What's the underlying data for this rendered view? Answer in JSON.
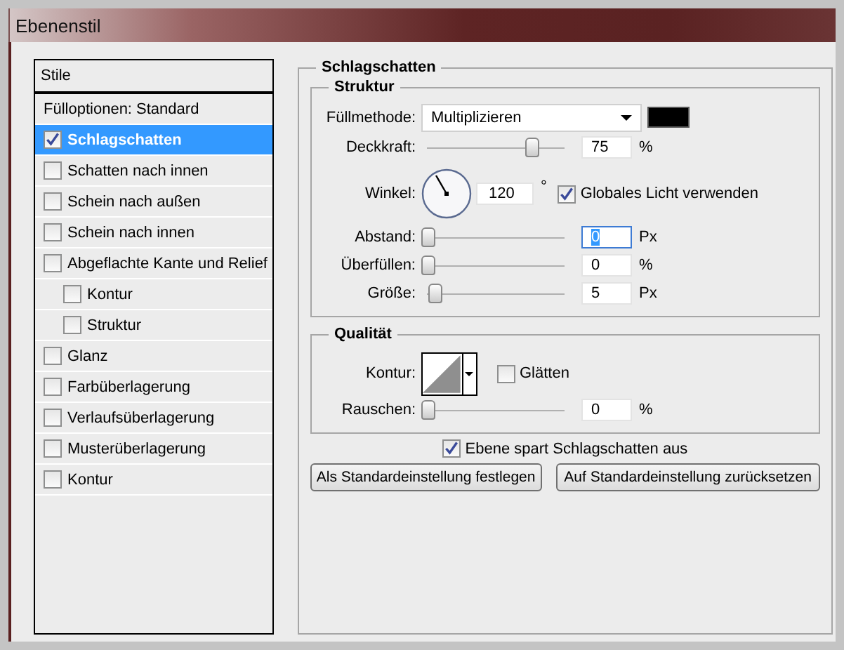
{
  "window": {
    "title": "Ebenenstil"
  },
  "styles": {
    "header": "Stile",
    "items": [
      {
        "label": "Fülloptionen: Standard",
        "kind": "plain",
        "selected": false
      },
      {
        "label": "Schlagschatten",
        "kind": "check",
        "checked": true,
        "selected": true
      },
      {
        "label": "Schatten nach innen",
        "kind": "check",
        "checked": false,
        "selected": false
      },
      {
        "label": "Schein nach außen",
        "kind": "check",
        "checked": false,
        "selected": false
      },
      {
        "label": "Schein nach innen",
        "kind": "check",
        "checked": false,
        "selected": false
      },
      {
        "label": "Abgeflachte Kante und Relief",
        "kind": "check",
        "checked": false,
        "selected": false,
        "children": [
          {
            "label": "Kontur",
            "kind": "check",
            "checked": false,
            "selected": false
          },
          {
            "label": "Struktur",
            "kind": "check",
            "checked": false,
            "selected": false
          }
        ]
      },
      {
        "label": "Glanz",
        "kind": "check",
        "checked": false,
        "selected": false
      },
      {
        "label": "Farbüberlagerung",
        "kind": "check",
        "checked": false,
        "selected": false
      },
      {
        "label": "Verlaufsüberlagerung",
        "kind": "check",
        "checked": false,
        "selected": false
      },
      {
        "label": "Musterüberlagerung",
        "kind": "check",
        "checked": false,
        "selected": false
      },
      {
        "label": "Kontur",
        "kind": "check",
        "checked": false,
        "selected": false
      }
    ]
  },
  "section": {
    "title": "Schlagschatten",
    "structure": {
      "title": "Struktur",
      "rows": [
        {
          "kind": "select",
          "label": "Füllmethode:",
          "value": "Multiplizieren"
        },
        {
          "kind": "slider",
          "label": "Deckkraft:",
          "level": 0.75,
          "value": "75",
          "unit": "%",
          "focused": false
        },
        {
          "kind": "angle",
          "label": "Winkel:",
          "value": "120",
          "unit": "°",
          "checkbox": {
            "label": "Globales Licht verwenden",
            "checked": true
          }
        },
        {
          "kind": "slider",
          "label": "Abstand:",
          "level": 0,
          "value": "0",
          "unit": "Px",
          "focused": true
        },
        {
          "kind": "slider",
          "label": "Überfüllen:",
          "level": 0,
          "value": "0",
          "unit": "%",
          "focused": false
        },
        {
          "kind": "slider",
          "label": "Größe:",
          "level": 0.05,
          "value": "5",
          "unit": "Px",
          "focused": false
        }
      ]
    },
    "quality": {
      "title": "Qualität",
      "rows": [
        {
          "kind": "contour",
          "label": "Kontur:",
          "checkbox": {
            "label": "Glätten",
            "checked": false
          }
        },
        {
          "kind": "slider",
          "label": "Rauschen:",
          "level": 0,
          "value": "0",
          "unit": "%",
          "focused": false
        }
      ]
    },
    "knockout": {
      "label": "Ebene spart Schlagschatten aus",
      "checked": true
    },
    "buttons": [
      "Als Standardeinstellung festlegen",
      "Auf Standardeinstellung zurücksetzen"
    ]
  }
}
